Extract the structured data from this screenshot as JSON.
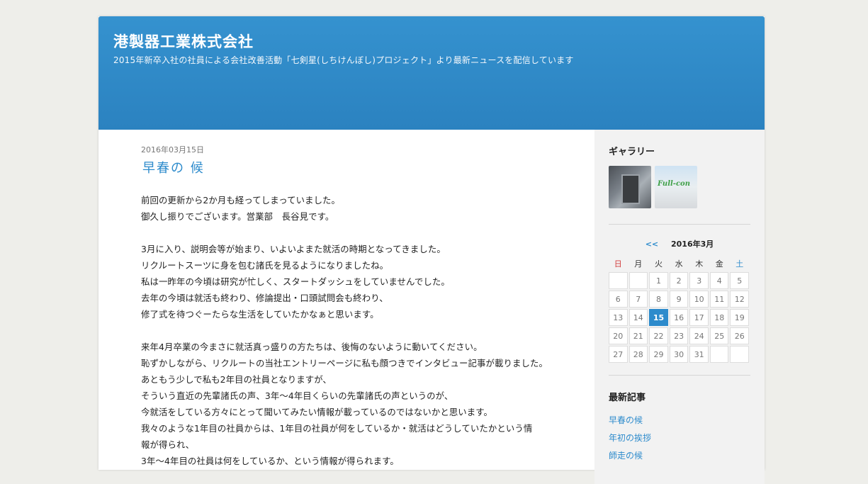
{
  "header": {
    "title": "港製器工業株式会社",
    "description": "2015年新卒入社の社員による会社改善活動「七剣星(しちけんぼし)プロジェクト」より最新ニュースを配信しています"
  },
  "post": {
    "date": "2016年03月15日",
    "title": "早春の 候",
    "paragraphs": [
      [
        "前回の更新から2か月も経ってしまっていました。",
        "御久し振りでございます。営業部　長谷見です。"
      ],
      [
        "3月に入り、説明会等が始まり、いよいよまた就活の時期となってきました。",
        "リクルートスーツに身を包む諸氏を見るようになりましたね。",
        "私は一昨年の今頃は研究が忙しく、スタートダッシュをしていませんでした。",
        "去年の今頃は就活も終わり、修論提出・口頭試問会も終わり、",
        "修了式を待つぐーたらな生活をしていたかなぁと思います。"
      ],
      [
        "来年4月卒業の今まさに就活真っ盛りの方たちは、後悔のないように動いてください。",
        "恥ずかしながら、リクルートの当社エントリーページに私も顔つきでインタビュー記事が載りました。",
        "あともう少しで私も2年目の社員となりますが、",
        "そういう直近の先輩諸氏の声、3年～4年目くらいの先輩諸氏の声というのが、",
        "今就活をしている方々にとって聞いてみたい情報が載っているのではないかと思います。",
        "我々のような1年目の社員からは、1年目の社員が何をしているか・就活はどうしていたかという情",
        "報が得られ、",
        "3年～4年目の社員は何をしているか、という情報が得られます。"
      ]
    ]
  },
  "sidebar": {
    "gallery": {
      "title": "ギャラリー",
      "thumb2_text": "Full-con"
    },
    "calendar": {
      "prev_label": "<<",
      "month_label": "2016年3月",
      "weekdays": [
        "日",
        "月",
        "火",
        "水",
        "木",
        "金",
        "土"
      ],
      "weeks": [
        [
          "",
          "",
          "1",
          "2",
          "3",
          "4",
          "5"
        ],
        [
          "6",
          "7",
          "8",
          "9",
          "10",
          "11",
          "12"
        ],
        [
          "13",
          "14",
          "15",
          "16",
          "17",
          "18",
          "19"
        ],
        [
          "20",
          "21",
          "22",
          "23",
          "24",
          "25",
          "26"
        ],
        [
          "27",
          "28",
          "29",
          "30",
          "31",
          "",
          ""
        ]
      ],
      "today": "15"
    },
    "recent": {
      "title": "最新記事",
      "items": [
        "早春の候",
        "年初の挨拶",
        "師走の候"
      ]
    }
  },
  "colors": {
    "header_blue": "#2b82c0",
    "link_blue": "#2d8bcc",
    "sunday_red": "#d23d3d"
  }
}
